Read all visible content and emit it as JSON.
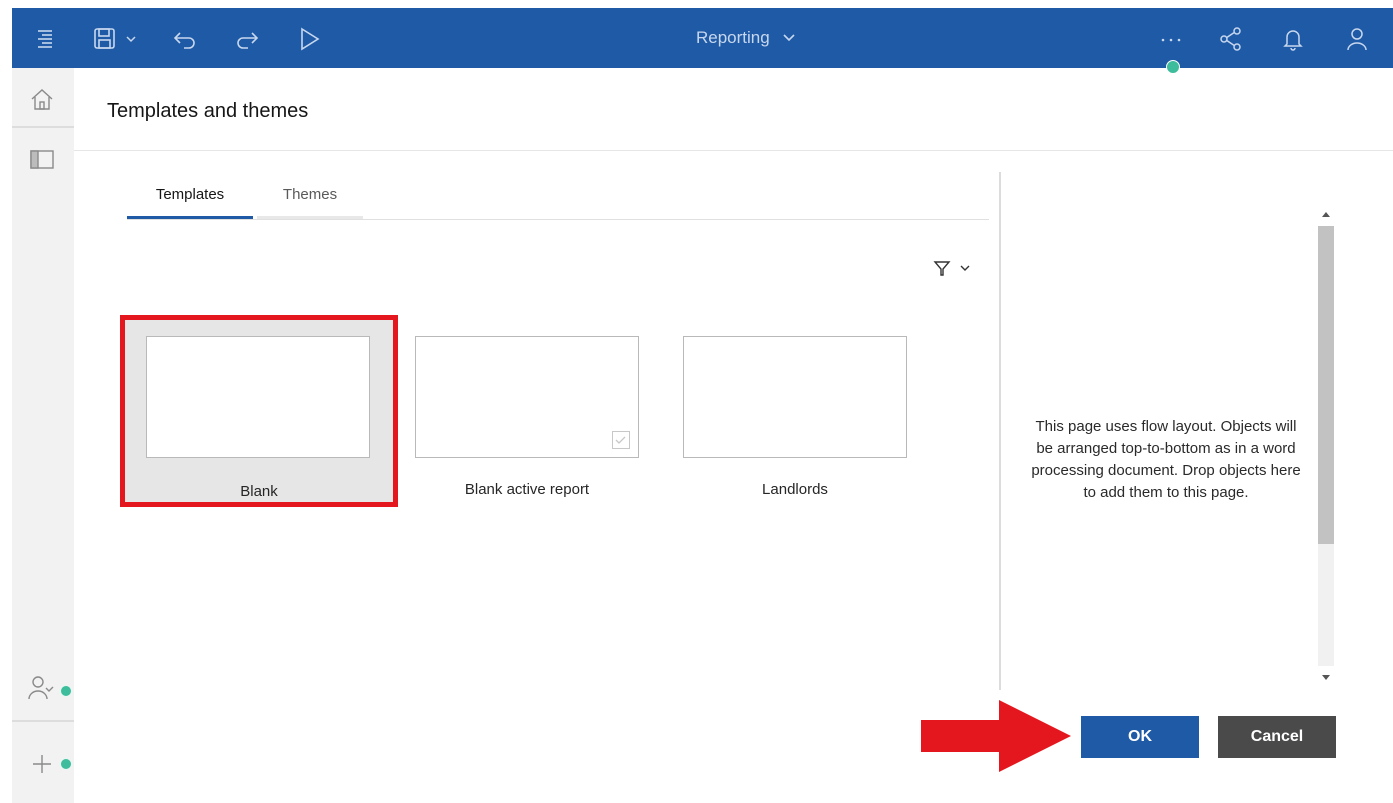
{
  "app": {
    "title": "Reporting"
  },
  "dialog": {
    "title": "Templates and themes",
    "tabs": [
      {
        "label": "Templates",
        "active": true
      },
      {
        "label": "Themes",
        "active": false
      }
    ],
    "templates": [
      {
        "label": "Blank",
        "selected": true
      },
      {
        "label": "Blank active report",
        "selected": false
      },
      {
        "label": "Landlords",
        "selected": false
      }
    ],
    "preview_text": "This page uses flow layout. Objects will be arranged top-to-bottom as in a word processing document. Drop objects here to add them to this page.",
    "ok_label": "OK",
    "cancel_label": "Cancel"
  },
  "toolbar": {
    "icons": [
      "menu-icon",
      "save-icon",
      "undo-icon",
      "redo-icon",
      "run-icon",
      "more-icon",
      "share-icon",
      "bell-icon",
      "user-icon"
    ]
  },
  "colors": {
    "brand": "#1f5aa6",
    "highlight": "#e4171e",
    "status_green": "#3dbd9c",
    "cancel": "#4a4a4a"
  }
}
